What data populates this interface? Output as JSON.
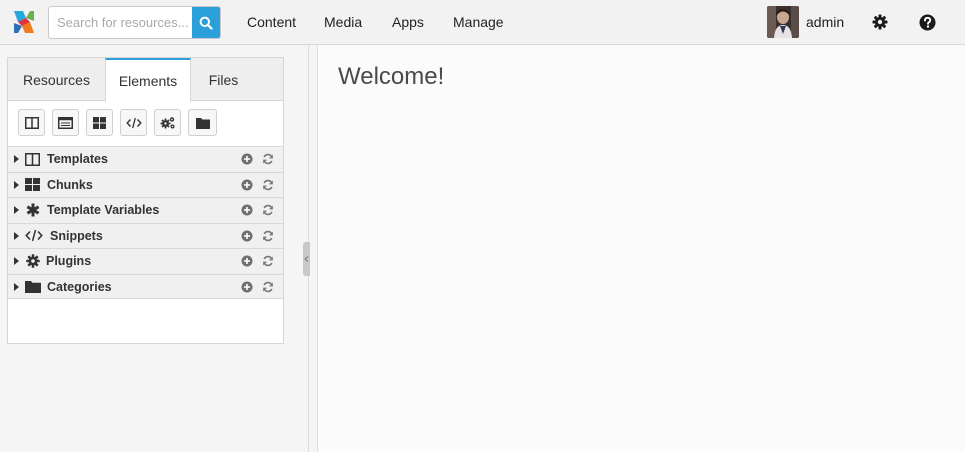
{
  "header": {
    "search_placeholder": "Search for resources...",
    "nav": [
      "Content",
      "Media",
      "Apps",
      "Manage"
    ],
    "username": "admin"
  },
  "sidebar": {
    "tabs": [
      {
        "label": "Resources",
        "active": false
      },
      {
        "label": "Elements",
        "active": true
      },
      {
        "label": "Files",
        "active": false
      }
    ],
    "toolbar_icons": [
      "template-icon",
      "tv-icon",
      "chunk-icon",
      "snippet-icon",
      "plugin-icon",
      "category-icon"
    ],
    "items": [
      {
        "label": "Templates",
        "icon": "columns-icon"
      },
      {
        "label": "Chunks",
        "icon": "grid-icon"
      },
      {
        "label": "Template Variables",
        "icon": "asterisk-icon"
      },
      {
        "label": "Snippets",
        "icon": "code-icon"
      },
      {
        "label": "Plugins",
        "icon": "cog-icon"
      },
      {
        "label": "Categories",
        "icon": "folder-icon"
      }
    ]
  },
  "main": {
    "title": "Welcome!"
  },
  "colors": {
    "accent": "#2b9fd9",
    "topbar": "#f2f2f2",
    "tree_row": "#f0f0f0"
  }
}
